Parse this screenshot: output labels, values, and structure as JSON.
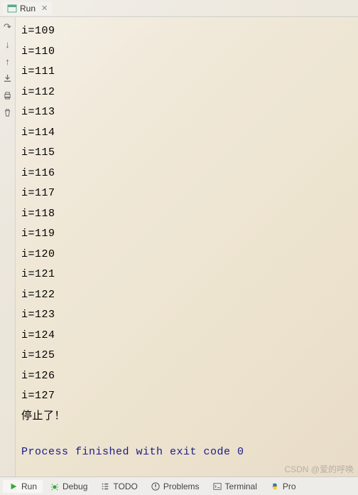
{
  "tab": {
    "label": "Run",
    "icon": "run-window-icon"
  },
  "gutter_icons": [
    "step-over",
    "step-into",
    "step-out",
    "download",
    "print",
    "trash"
  ],
  "console": {
    "lines": [
      "i=109",
      "i=110",
      "i=111",
      "i=112",
      "i=113",
      "i=114",
      "i=115",
      "i=116",
      "i=117",
      "i=118",
      "i=119",
      "i=120",
      "i=121",
      "i=122",
      "i=123",
      "i=124",
      "i=125",
      "i=126",
      "i=127",
      "停止了！"
    ],
    "exit_message": "Process finished with exit code 0"
  },
  "bottom_bar": {
    "items": [
      {
        "icon": "play",
        "label": "Run",
        "active": true
      },
      {
        "icon": "bug",
        "label": "Debug",
        "active": false
      },
      {
        "icon": "list",
        "label": "TODO",
        "active": false
      },
      {
        "icon": "alert",
        "label": "Problems",
        "active": false
      },
      {
        "icon": "terminal",
        "label": "Terminal",
        "active": false
      },
      {
        "icon": "python",
        "label": "Pro",
        "active": false
      }
    ]
  },
  "watermark": "CSDN @爱的呼唤"
}
